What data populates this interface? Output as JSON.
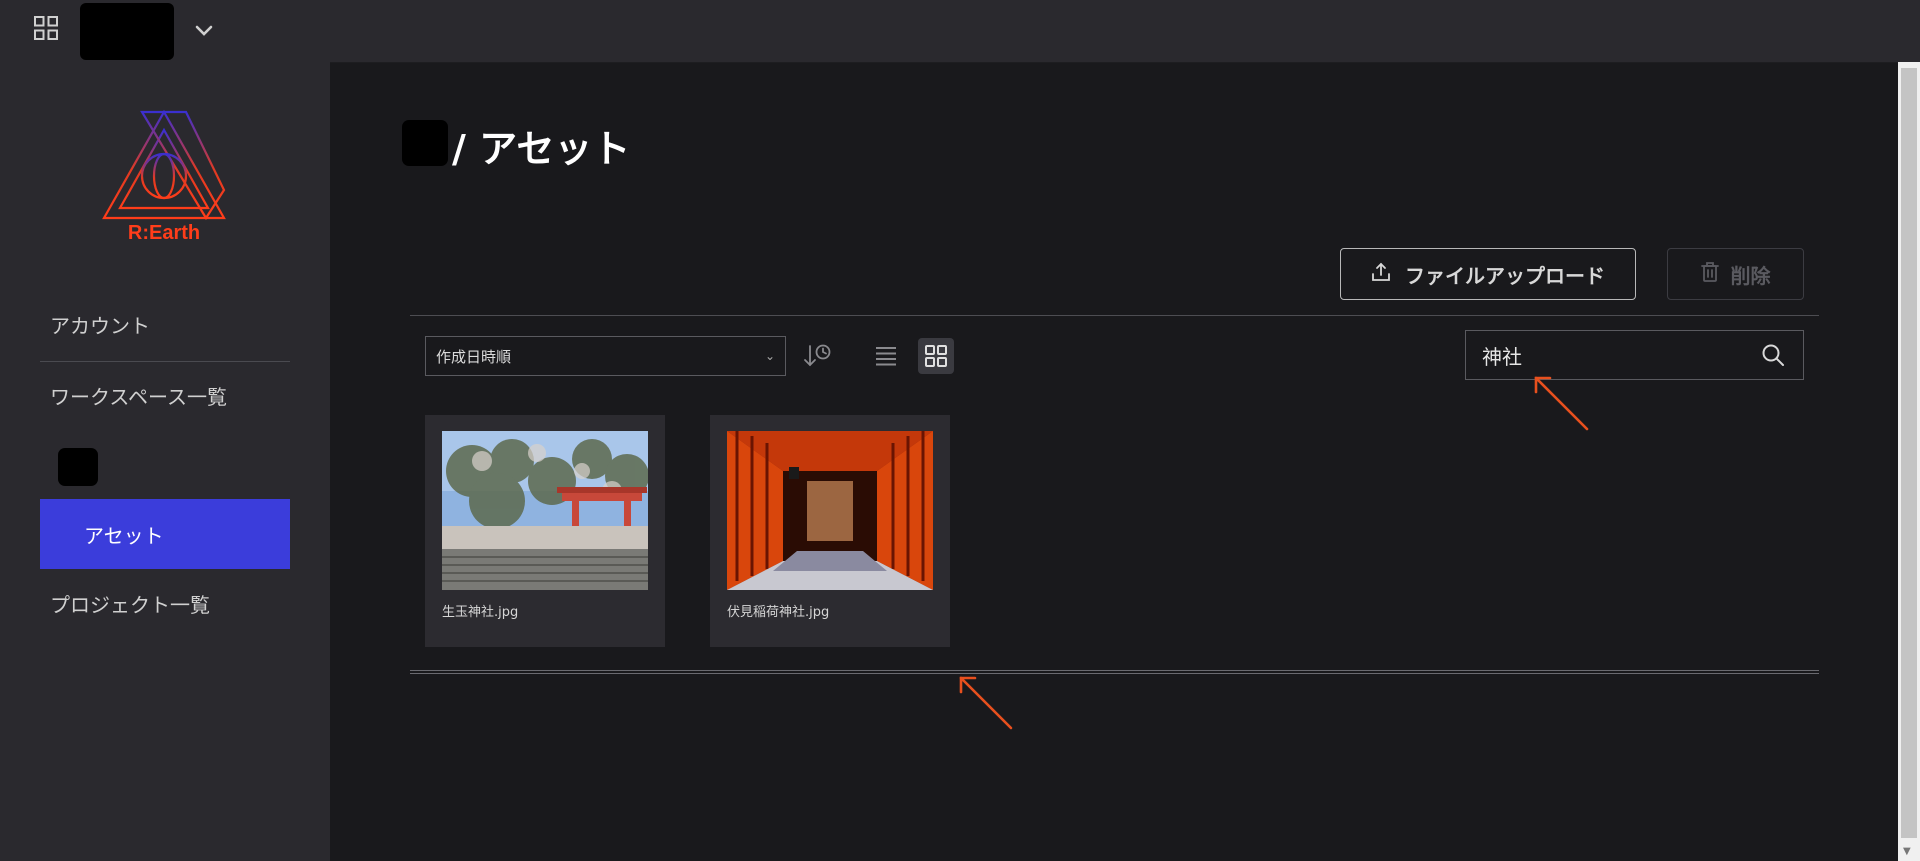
{
  "topbar": {
    "apps_icon": "grid-apps-icon",
    "dropdown_icon": "chevron-down-icon"
  },
  "sidebar": {
    "logo_text": "R:Earth",
    "items": [
      {
        "label": "アカウント"
      },
      {
        "label": "ワークスペース一覧"
      },
      {
        "label": "アセット",
        "active": true
      },
      {
        "label": "プロジェクト一覧"
      }
    ],
    "active_color": "#3b3ddb"
  },
  "page": {
    "title": "/ アセット"
  },
  "toolbar": {
    "upload_label": "ファイルアップロード",
    "upload_icon": "upload-icon",
    "delete_label": "削除",
    "delete_icon": "trash-icon"
  },
  "filters": {
    "sort_value": "作成日時順",
    "search_value": "神社",
    "view_mode": "grid"
  },
  "assets": [
    {
      "name": "生玉神社.jpg"
    },
    {
      "name": "伏見稲荷神社.jpg"
    }
  ],
  "annotation_color": "#e8501e"
}
